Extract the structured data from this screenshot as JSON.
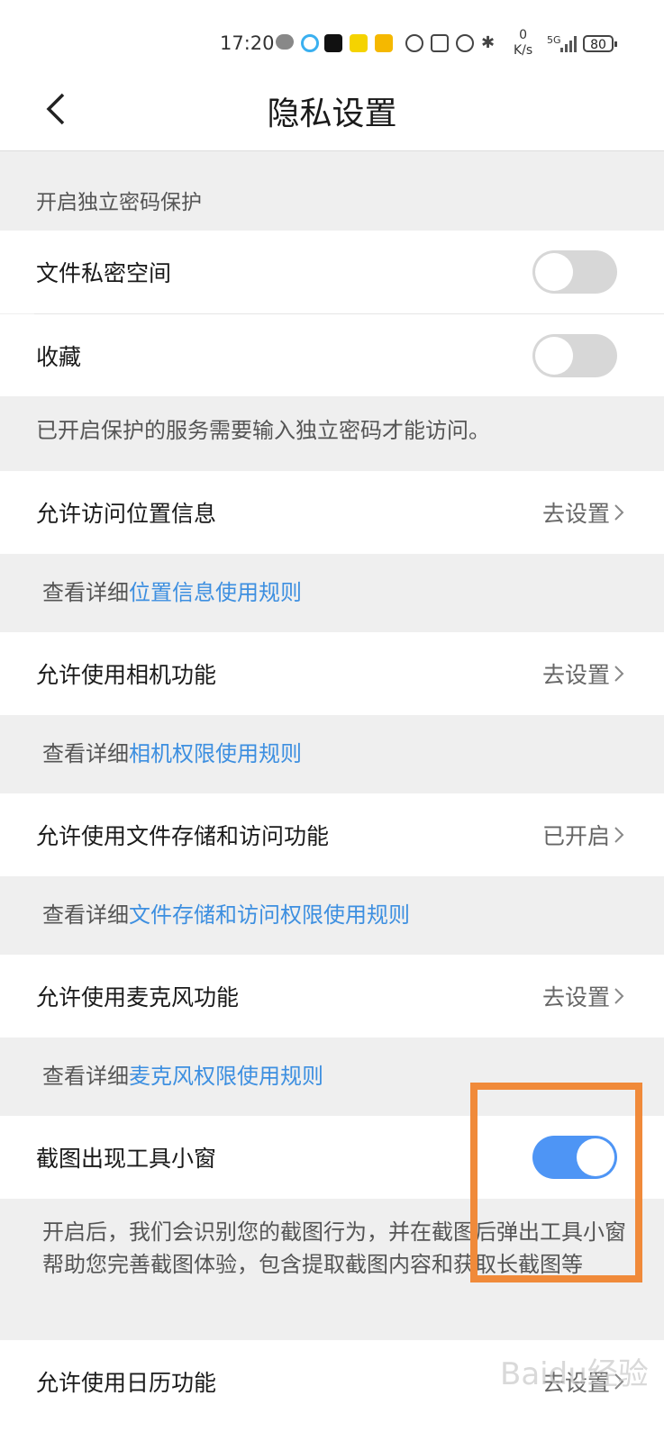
{
  "status_bar": {
    "time": "17:20",
    "net_speed_value": "0",
    "net_speed_unit": "K/s",
    "network": "5G",
    "battery": "80"
  },
  "header": {
    "title": "隐私设置"
  },
  "password_section": {
    "heading": "开启独立密码保护",
    "items": [
      {
        "label": "文件私密空间",
        "enabled": false
      },
      {
        "label": "收藏",
        "enabled": false
      }
    ],
    "footer": "已开启保护的服务需要输入独立密码才能访问。"
  },
  "permissions": [
    {
      "label": "允许访问位置信息",
      "action": "去设置",
      "note_prefix": "查看详细",
      "note_link": "位置信息使用规则"
    },
    {
      "label": "允许使用相机功能",
      "action": "去设置",
      "note_prefix": "查看详细",
      "note_link": "相机权限使用规则"
    },
    {
      "label": "允许使用文件存储和访问功能",
      "action": "已开启",
      "note_prefix": "查看详细",
      "note_link": "文件存储和访问权限使用规则"
    },
    {
      "label": "允许使用麦克风功能",
      "action": "去设置",
      "note_prefix": "查看详细",
      "note_link": "麦克风权限使用规则"
    }
  ],
  "screenshot_tool": {
    "label": "截图出现工具小窗",
    "enabled": true,
    "description": "开启后，我们会识别您的截图行为，并在截图后弹出工具小窗帮助您完善截图体验，包含提取截图内容和获取长截图等"
  },
  "calendar": {
    "label": "允许使用日历功能",
    "action": "去设置"
  },
  "watermark": "Baidu经验",
  "colors": {
    "accent": "#4e95f5",
    "link": "#3d8fe0",
    "highlight": "#f08a3a"
  }
}
